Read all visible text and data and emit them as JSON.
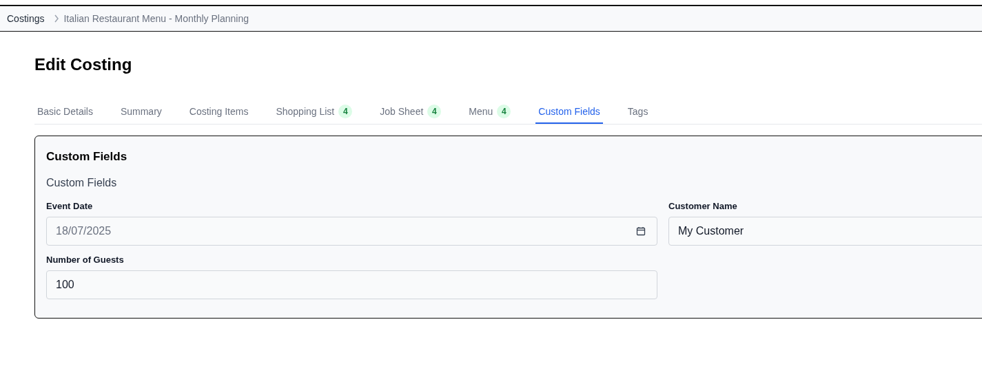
{
  "breadcrumb": [
    {
      "label": "Costings"
    },
    {
      "label": "Italian Restaurant Menu - Monthly Planning"
    }
  ],
  "title": "Edit Costing",
  "tabs": [
    {
      "label": "Basic Details",
      "selected": false
    },
    {
      "label": "Summary",
      "selected": false
    },
    {
      "label": "Costing Items",
      "selected": false
    },
    {
      "label": "Shopping List",
      "badge": "4",
      "selected": false
    },
    {
      "label": "Job Sheet",
      "badge": "4",
      "selected": false
    },
    {
      "label": "Menu",
      "badge": "4",
      "selected": false
    },
    {
      "label": "Custom Fields",
      "selected": true
    },
    {
      "label": "Tags",
      "selected": false
    }
  ],
  "card": {
    "title": "Custom Fields",
    "section": "Custom Fields",
    "fields": [
      {
        "label": "Event Date",
        "kind": "date",
        "value": "18/07/2025"
      },
      {
        "label": "Customer Name",
        "kind": "text",
        "value": "My Customer"
      },
      {
        "label": "Number of Guests",
        "kind": "text",
        "value": "100"
      }
    ]
  }
}
